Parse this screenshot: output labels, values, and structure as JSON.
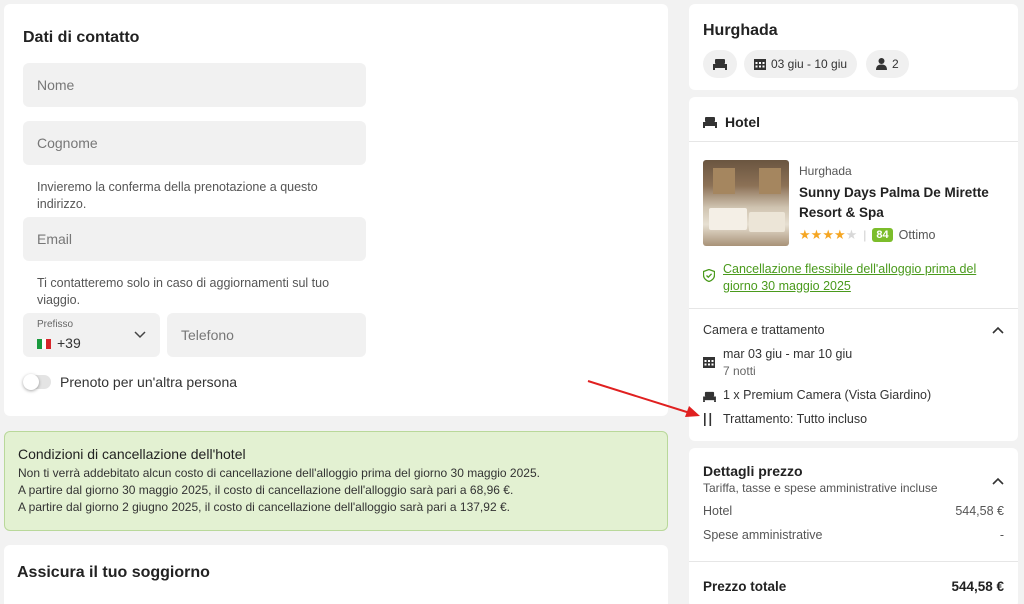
{
  "contact": {
    "title": "Dati di contatto",
    "name_placeholder": "Nome",
    "surname_placeholder": "Cognome",
    "email_hint": "Invieremo la conferma della prenotazione a questo indirizzo.",
    "email_placeholder": "Email",
    "phone_hint": "Ti contatteremo solo in caso di aggiornamenti sul tuo viaggio.",
    "prefix_label": "Prefisso",
    "prefix_value": "+39",
    "phone_placeholder": "Telefono",
    "other_person_label": "Prenoto per un'altra persona"
  },
  "cancellation": {
    "title": "Condizioni di cancellazione dell'hotel",
    "lines": [
      "Non ti verrà addebitato alcun costo di cancellazione dell'alloggio prima del giorno 30 maggio 2025.",
      "A partire dal giorno 30 maggio 2025, il costo di cancellazione dell'alloggio sarà pari a 68,96 €.",
      "A partire dal giorno 2 giugno 2025, il costo di cancellazione dell'alloggio sarà pari a 137,92 €."
    ]
  },
  "insurance": {
    "title": "Assicura il tuo soggiorno"
  },
  "trip": {
    "destination": "Hurghada",
    "dates": "03 giu - 10 giu",
    "guests": "2"
  },
  "hotel": {
    "section_title": "Hotel",
    "city": "Hurghada",
    "name": "Sunny Days Palma De Mirette Resort & Spa",
    "stars": 4,
    "score": "84",
    "score_label": "Ottimo",
    "flex_cancel": "Cancellazione flessibile dell'alloggio prima del giorno 30 maggio 2025",
    "room_section_title": "Camera e trattamento",
    "dates": "mar 03 giu - mar 10 giu",
    "nights": "7 notti",
    "room": "1 x Premium Camera (Vista Giardino)",
    "board": "Trattamento: Tutto incluso"
  },
  "price": {
    "title": "Dettagli prezzo",
    "subtitle": "Tariffa, tasse e spese amministrative incluse",
    "rows": [
      {
        "label": "Hotel",
        "value": "544,58 €"
      },
      {
        "label": "Spese amministrative",
        "value": "-"
      }
    ],
    "total_label": "Prezzo totale",
    "total_value": "544,58 €"
  },
  "colors": {
    "accent_green": "#4a9a1c",
    "score_green": "#7cbd2b",
    "star": "#f5a623",
    "arrow": "#e02020"
  }
}
